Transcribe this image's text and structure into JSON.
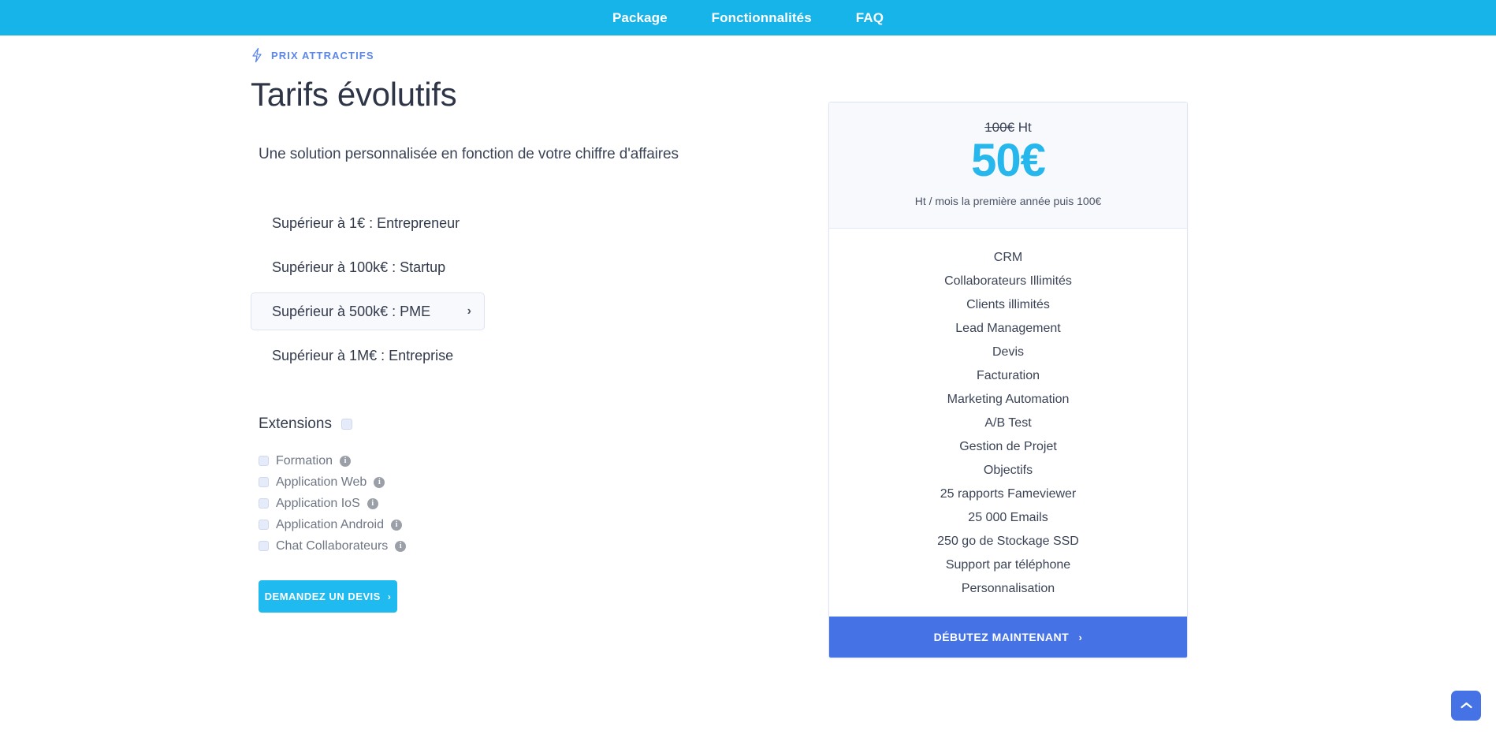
{
  "nav": {
    "items": [
      {
        "label": "Package"
      },
      {
        "label": "Fonctionnalités"
      },
      {
        "label": "FAQ"
      }
    ],
    "background_color": "#17b4e9"
  },
  "hero": {
    "eyebrow_icon": "bolt-icon",
    "eyebrow": "PRIX ATTRACTIFS",
    "eyebrow_color": "#5b86ea",
    "title": "Tarifs évolutifs",
    "subtitle": "Une solution personnalisée en fonction de votre chiffre d'affaires"
  },
  "tiers": {
    "items": [
      {
        "label": "Supérieur à 1€ : Entrepreneur",
        "selected": false
      },
      {
        "label": "Supérieur à 100k€ : Startup",
        "selected": false
      },
      {
        "label": "Supérieur à 500k€ : PME",
        "selected": true
      },
      {
        "label": "Supérieur à 1M€ : Entreprise",
        "selected": false
      }
    ],
    "chevron": "›"
  },
  "extensions": {
    "title": "Extensions",
    "master_checked": false,
    "items": [
      {
        "label": "Formation",
        "checked": false,
        "info": "info-icon"
      },
      {
        "label": "Application Web",
        "checked": false,
        "info": "info-icon"
      },
      {
        "label": "Application IoS",
        "checked": false,
        "info": "info-icon"
      },
      {
        "label": "Application Android",
        "checked": false,
        "info": "info-icon"
      },
      {
        "label": "Chat Collaborateurs",
        "checked": false,
        "info": "info-icon"
      }
    ],
    "info_glyph": "i"
  },
  "quote_button": {
    "label": "DEMANDEZ UN DEVIS",
    "arrow": "›",
    "color": "#1fbaef"
  },
  "price_card": {
    "old_price": "100€",
    "old_price_suffix": " Ht",
    "price": "50€",
    "price_color": "#26b7ec",
    "note": "Ht / mois la première année puis 100€",
    "features": [
      "CRM",
      "Collaborateurs Illimités",
      "Clients illimités",
      "Lead Management",
      "Devis",
      "Facturation",
      "Marketing Automation",
      "A/B Test",
      "Gestion de Projet",
      "Objectifs",
      "25 rapports Fameviewer",
      "25 000 Emails",
      "250 go de Stockage SSD",
      "Support par téléphone",
      "Personnalisation"
    ],
    "cta": {
      "label": "DÉBUTEZ MAINTENANT",
      "arrow": "›",
      "color": "#4572e4"
    }
  },
  "scroll_top": {
    "icon": "chevron-up-icon",
    "color": "#4572e4"
  }
}
